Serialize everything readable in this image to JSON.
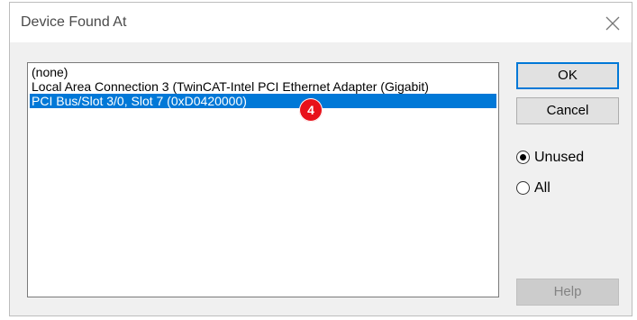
{
  "dialog": {
    "title": "Device Found At",
    "list_items": [
      {
        "label": "(none)",
        "selected": false
      },
      {
        "label": "Local Area Connection 3 (TwinCAT-Intel PCI Ethernet Adapter (Gigabit)",
        "selected": false
      },
      {
        "label": "PCI Bus/Slot 3/0, Slot 7 (0xD0420000)",
        "selected": true
      }
    ],
    "badge": "4",
    "buttons": {
      "ok": "OK",
      "cancel": "Cancel",
      "help": "Help"
    },
    "radios": [
      {
        "label": "Unused",
        "checked": true
      },
      {
        "label": "All",
        "checked": false
      }
    ]
  },
  "colors": {
    "selection": "#0078d7",
    "badge": "#e8111a"
  },
  "icons": {
    "close": "close-icon"
  }
}
